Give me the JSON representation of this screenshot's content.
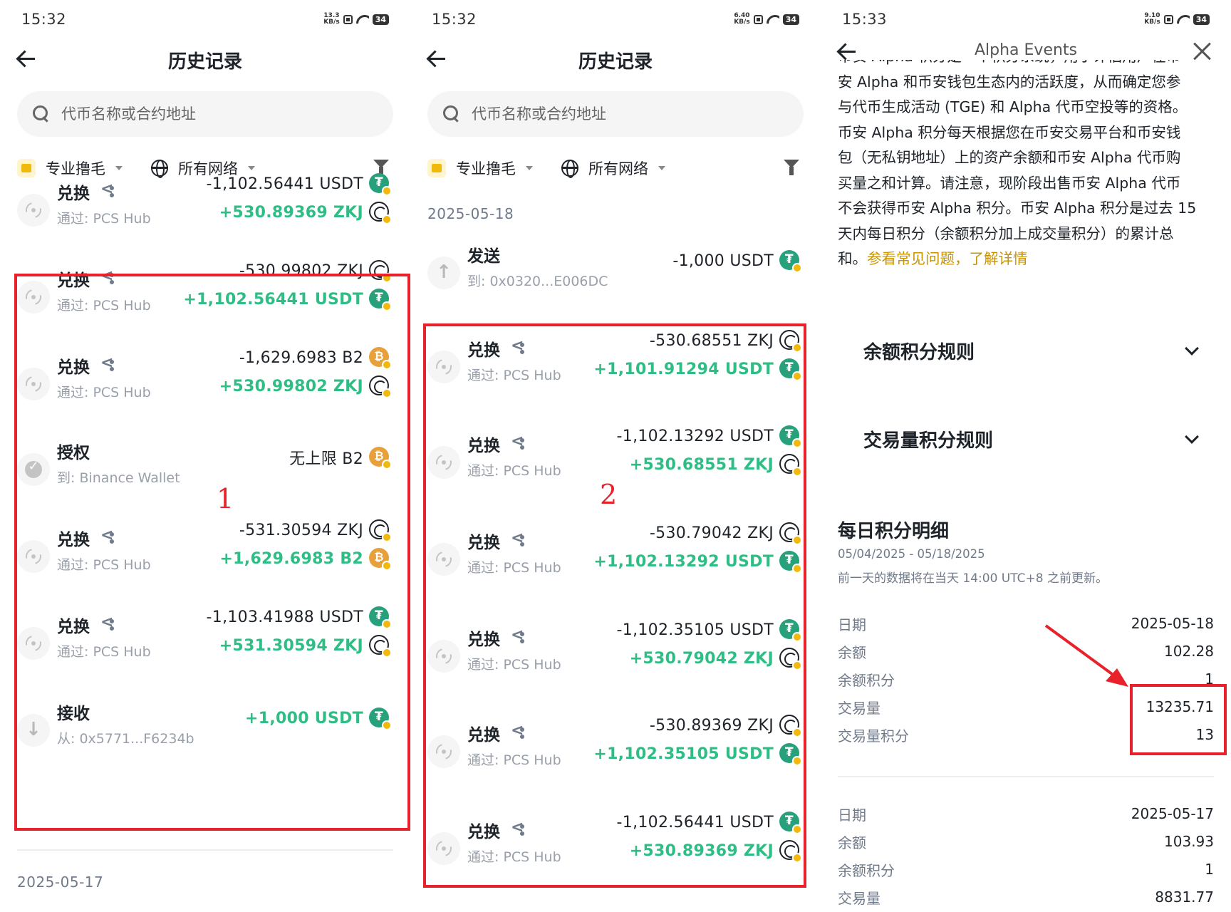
{
  "panel1": {
    "status": {
      "time": "15:32",
      "speed_top": "13.3",
      "speed_unit": "KB/s",
      "battery": "34"
    },
    "title": "历史记录",
    "search_placeholder": "代币名称或合约地址",
    "filter_wallet": "专业撸毛",
    "filter_network": "所有网络",
    "date_bottom": "2025-05-17",
    "annotation": "1",
    "transactions": [
      {
        "type": "兑换",
        "via": "通过: PCS Hub",
        "out": "-1,102.56441 USDT",
        "in": "+530.89369 ZKJ"
      },
      {
        "type": "兑换",
        "via": "通过: PCS Hub",
        "out": "-530.99802 ZKJ",
        "in": "+1,102.56441 USDT"
      },
      {
        "type": "兑换",
        "via": "通过: PCS Hub",
        "out": "-1,629.6983 B2",
        "in": "+530.99802 ZKJ"
      },
      {
        "type": "授权",
        "via": "到: Binance Wallet",
        "amount": "无上限 B2"
      },
      {
        "type": "兑换",
        "via": "通过: PCS Hub",
        "out": "-531.30594 ZKJ",
        "in": "+1,629.6983 B2"
      },
      {
        "type": "兑换",
        "via": "通过: PCS Hub",
        "out": "-1,103.41988 USDT",
        "in": "+531.30594 ZKJ"
      },
      {
        "type": "接收",
        "via": "从: 0x5771...F6234b",
        "amount": "+1,000 USDT"
      }
    ]
  },
  "panel2": {
    "status": {
      "time": "15:32",
      "speed_top": "6.40",
      "speed_unit": "KB/s",
      "battery": "34"
    },
    "title": "历史记录",
    "search_placeholder": "代币名称或合约地址",
    "filter_wallet": "专业撸毛",
    "filter_network": "所有网络",
    "date_top": "2025-05-18",
    "annotation": "2",
    "transactions": [
      {
        "type": "发送",
        "via": "到: 0x0320...E006DC",
        "amount": "-1,000 USDT"
      },
      {
        "type": "兑换",
        "via": "通过: PCS Hub",
        "out": "-530.68551 ZKJ",
        "in": "+1,101.91294 USDT"
      },
      {
        "type": "兑换",
        "via": "通过: PCS Hub",
        "out": "-1,102.13292 USDT",
        "in": "+530.68551 ZKJ"
      },
      {
        "type": "兑换",
        "via": "通过: PCS Hub",
        "out": "-530.79042 ZKJ",
        "in": "+1,102.13292 USDT"
      },
      {
        "type": "兑换",
        "via": "通过: PCS Hub",
        "out": "-1,102.35105 USDT",
        "in": "+530.79042 ZKJ"
      },
      {
        "type": "兑换",
        "via": "通过: PCS Hub",
        "out": "-530.89369 ZKJ",
        "in": "+1,102.35105 USDT"
      },
      {
        "type": "兑换",
        "via": "通过: PCS Hub",
        "out": "-1,102.56441 USDT",
        "in": "+530.89369 ZKJ"
      }
    ]
  },
  "panel3": {
    "status": {
      "time": "15:33",
      "speed_top": "9.10",
      "speed_unit": "KB/s",
      "battery": "34"
    },
    "title": "Alpha Events",
    "article_lines": [
      "币安 Alpha 积分是一个积分系统，用于评估用户在币",
      "安 Alpha 和币安钱包生态内的活跃度，从而确定您参",
      "与代币生成活动 (TGE) 和 Alpha 代币空投等的资格。",
      "币安 Alpha 积分每天根据您在币安交易平台和币安钱",
      "包（无私钥地址）上的资产余额和币安 Alpha 代币购",
      "买量之和计算。请注意，现阶段出售币安 Alpha 代币",
      "不会获得币安 Alpha 积分。币安 Alpha 积分是过去 15",
      "天内每日积分（余额积分加上成交量积分）的累计总"
    ],
    "article_last": "和。",
    "faq_link": "参看常见问题，了解详情",
    "accordion_balance": "余额积分规则",
    "accordion_volume": "交易量积分规则",
    "section_title": "每日积分明细",
    "section_range": "05/04/2025 - 05/18/2025",
    "section_note": "前一天的数据将在当天 14:00 UTC+8 之前更新。",
    "day1": {
      "date_label": "日期",
      "date_value": "2025-05-18",
      "balance_label": "余额",
      "balance_value": "102.28",
      "balance_points_label": "余额积分",
      "balance_points_value": "1",
      "volume_label": "交易量",
      "volume_value": "13235.71",
      "volume_points_label": "交易量积分",
      "volume_points_value": "13"
    },
    "day2": {
      "date_label": "日期",
      "date_value": "2025-05-17",
      "balance_label": "余额",
      "balance_value": "103.93",
      "balance_points_label": "余额积分",
      "balance_points_value": "1",
      "volume_label": "交易量",
      "volume_value": "8831.77"
    }
  },
  "colors": {
    "positive": "#2ebd85",
    "annotation_red": "#e8212a",
    "link_gold": "#c99400",
    "usdt": "#26a17b",
    "b2": "#e8a13a"
  }
}
